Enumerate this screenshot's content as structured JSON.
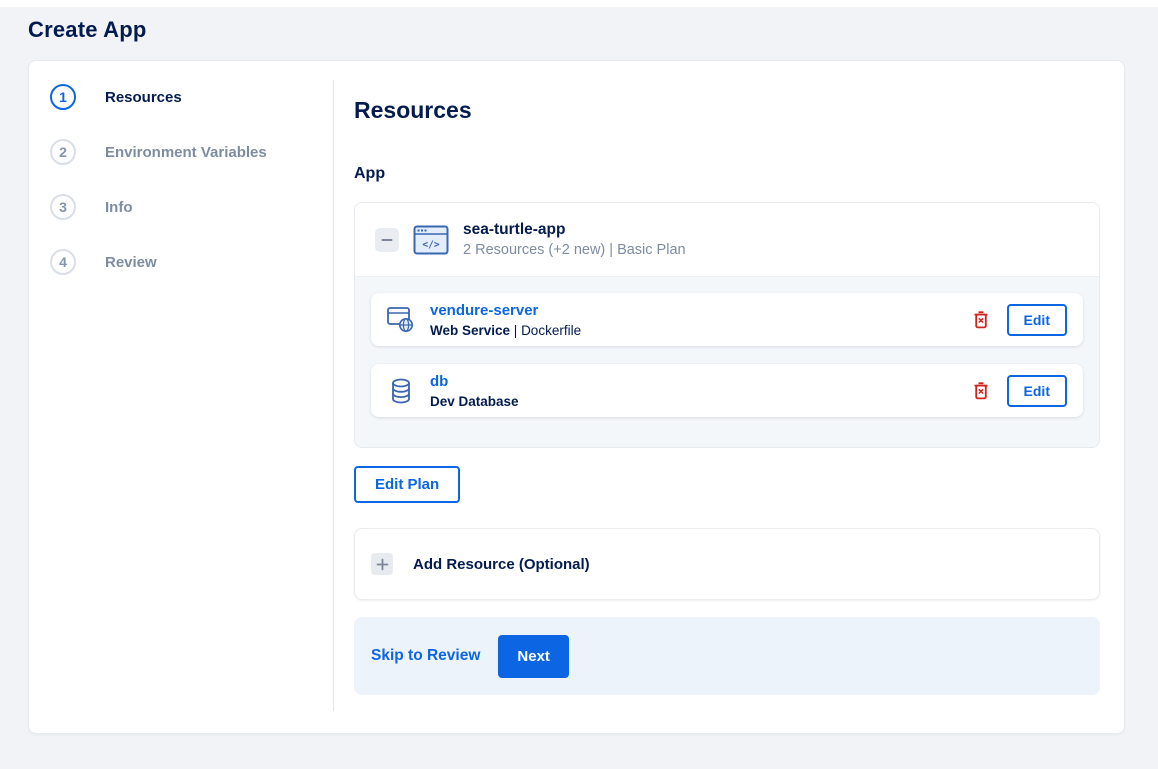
{
  "page": {
    "title": "Create App"
  },
  "colors": {
    "navy": "#031b4e",
    "accent": "#0c66e4",
    "muted": "#7e8ca1",
    "danger": "#d0231c",
    "page-bg": "#f1f3f6",
    "footer-bg": "#edf3fa",
    "app-body-bg": "#f4f7fa"
  },
  "icons": {
    "collapse": "minus",
    "app": "code-window",
    "web_service": "browser-globe",
    "database": "db-cylinder",
    "delete": "trash-x",
    "add": "plus"
  },
  "stepper": [
    {
      "number": "1",
      "label": "Resources",
      "active": true
    },
    {
      "number": "2",
      "label": "Environment Variables",
      "active": false
    },
    {
      "number": "3",
      "label": "Info",
      "active": false
    },
    {
      "number": "4",
      "label": "Review",
      "active": false
    }
  ],
  "main": {
    "heading": "Resources",
    "section_label": "App",
    "app": {
      "name": "sea-turtle-app",
      "summary": "2 Resources (+2 new) | Basic Plan",
      "resources": [
        {
          "name": "vendure-server",
          "type": "Web Service",
          "separator": " | ",
          "detail": "Dockerfile",
          "edit_label": "Edit"
        },
        {
          "name": "db",
          "type": "Dev Database",
          "separator": "",
          "detail": "",
          "edit_label": "Edit"
        }
      ]
    },
    "edit_plan_label": "Edit Plan",
    "add_resource_label": "Add Resource (Optional)",
    "footer": {
      "skip_label": "Skip to Review",
      "next_label": "Next"
    }
  }
}
